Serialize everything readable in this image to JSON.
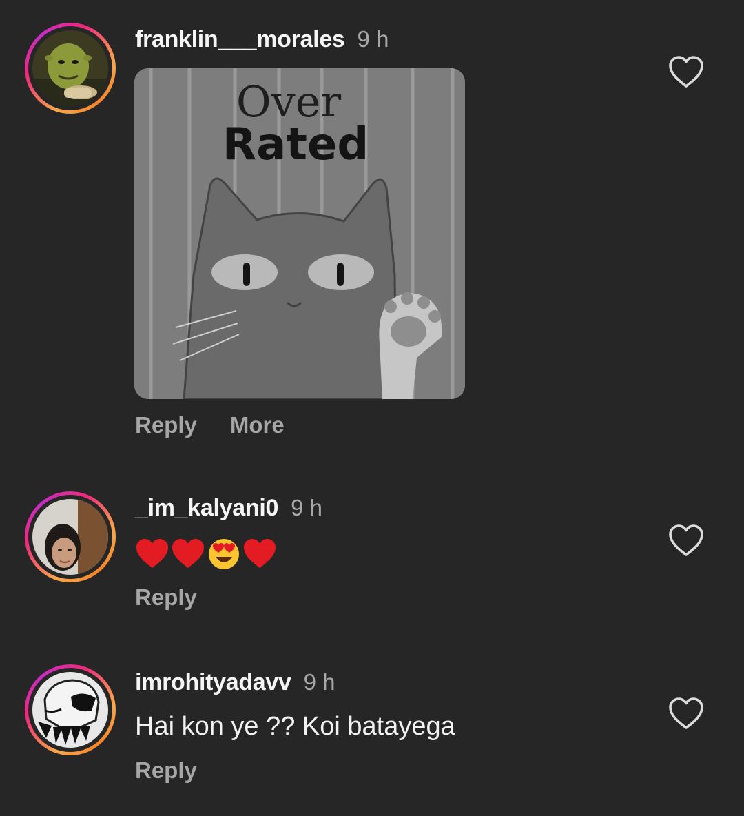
{
  "comments": [
    {
      "username": "franklin___morales",
      "time": "9 h",
      "sticker": {
        "line1": "Over",
        "line2": "Rated"
      },
      "actions": {
        "reply": "Reply",
        "more": "More"
      }
    },
    {
      "username": "_im_kalyani0",
      "time": "9 h",
      "emojis": [
        "red-heart",
        "red-heart",
        "heart-eyes-face",
        "red-heart"
      ],
      "actions": {
        "reply": "Reply"
      }
    },
    {
      "username": "imrohityadavv",
      "time": "9 h",
      "text": "Hai kon ye ?? Koi batayega",
      "actions": {
        "reply": "Reply"
      }
    }
  ],
  "icons": {
    "like": "heart-outline-icon"
  },
  "colors": {
    "background": "#262627",
    "secondary_text": "#a6a6a6",
    "story_ring": [
      "#f9a64a",
      "#ee2a7b",
      "#c72cc4"
    ]
  }
}
